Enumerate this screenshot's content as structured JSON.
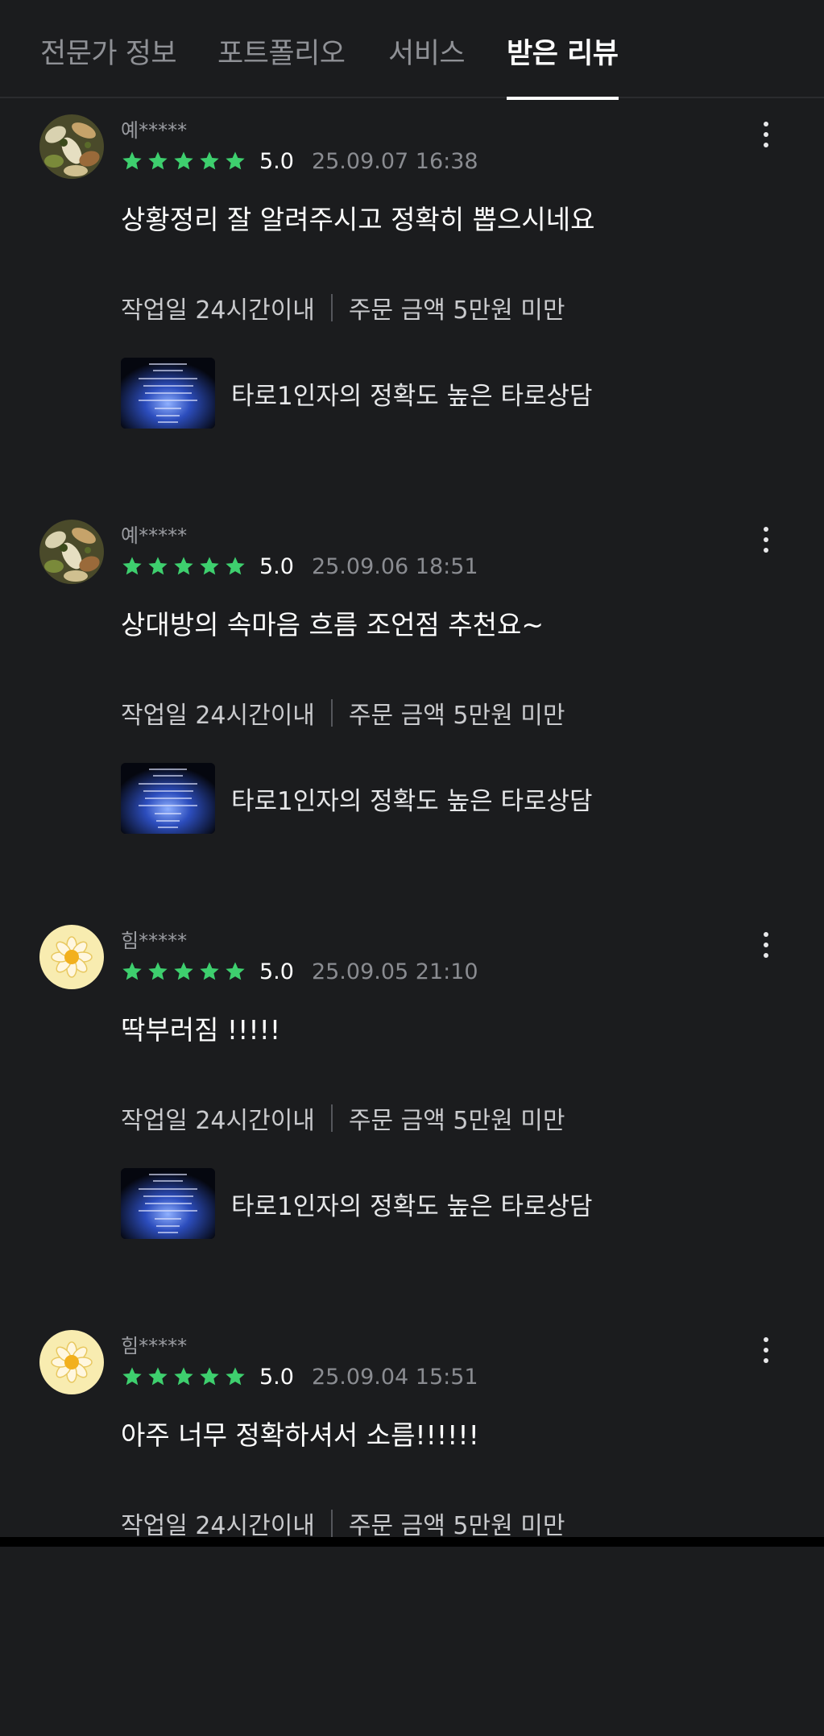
{
  "tabs": [
    {
      "label": "전문가 정보",
      "active": false
    },
    {
      "label": "포트폴리오",
      "active": false
    },
    {
      "label": "서비스",
      "active": false
    },
    {
      "label": "받은 리뷰",
      "active": true
    }
  ],
  "colors": {
    "background": "#1b1c1e",
    "star": "#3ecf6e",
    "muted_text": "#8a8c91"
  },
  "reviews": [
    {
      "avatar": "food-photo-avatar",
      "username": "예*****",
      "stars": 5,
      "score": "5.0",
      "date": "25.09.07 16:38",
      "content": "상황정리 잘 알려주시고 정확히 뽑으시네요",
      "work_period": "작업일 24시간이내",
      "order_amount": "주문 금액 5만원 미만",
      "service_title": "타로1인자의 정확도 높은 타로상담"
    },
    {
      "avatar": "food-photo-avatar",
      "username": "예*****",
      "stars": 5,
      "score": "5.0",
      "date": "25.09.06 18:51",
      "content": "상대방의 속마음 흐름 조언점 추천요~",
      "work_period": "작업일 24시간이내",
      "order_amount": "주문 금액 5만원 미만",
      "service_title": "타로1인자의 정확도 높은 타로상담"
    },
    {
      "avatar": "flower-avatar",
      "username": "힘*****",
      "stars": 5,
      "score": "5.0",
      "date": "25.09.05 21:10",
      "content": "딱부러짐 !!!!!",
      "work_period": "작업일 24시간이내",
      "order_amount": "주문 금액 5만원 미만",
      "service_title": "타로1인자의 정확도 높은 타로상담"
    },
    {
      "avatar": "flower-avatar",
      "username": "힘*****",
      "stars": 5,
      "score": "5.0",
      "date": "25.09.04 15:51",
      "content": "아주 너무 정확하셔서 소름!!!!!!",
      "work_period": "작업일 24시간이내",
      "order_amount": "주문 금액 5만원 미만",
      "service_title": ""
    }
  ]
}
